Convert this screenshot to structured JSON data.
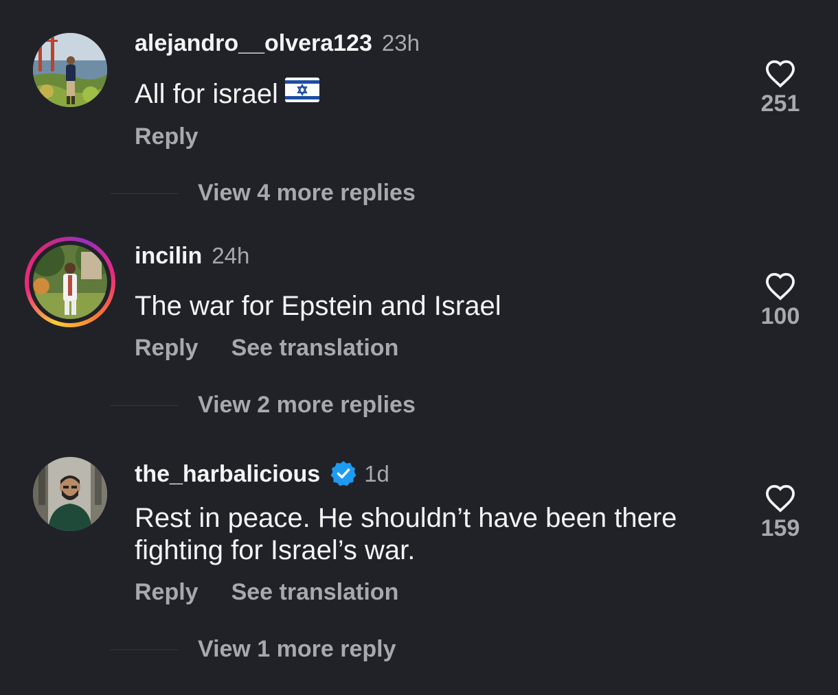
{
  "comments": [
    {
      "username": "alejandro__olvera123",
      "time": "23h",
      "text": "All for israel",
      "emoji": "israel-flag",
      "actions": {
        "reply": "Reply",
        "translate": ""
      },
      "likes": "251",
      "view_more": "View 4 more replies"
    },
    {
      "username": "incilin",
      "time": "24h",
      "text": "The war for Epstein and Israel",
      "actions": {
        "reply": "Reply",
        "translate": "See translation"
      },
      "likes": "100",
      "view_more": "View 2 more replies",
      "has_story_ring": true
    },
    {
      "username": "the_harbalicious",
      "verified": true,
      "time": "1d",
      "text_line1": "Rest in peace. He shouldn’t have been there",
      "text_line2": "fighting for Israel’s war.",
      "actions": {
        "reply": "Reply",
        "translate": "See translation"
      },
      "likes": "159",
      "view_more": "View 1 more reply"
    }
  ],
  "colors": {
    "background": "#212228",
    "primary_text": "#f4f4f6",
    "secondary_text": "#a8a9ae",
    "verified_badge": "#1d9bf0"
  },
  "icons": {
    "like": "heart-outline-icon",
    "verified": "verified-badge-icon"
  }
}
